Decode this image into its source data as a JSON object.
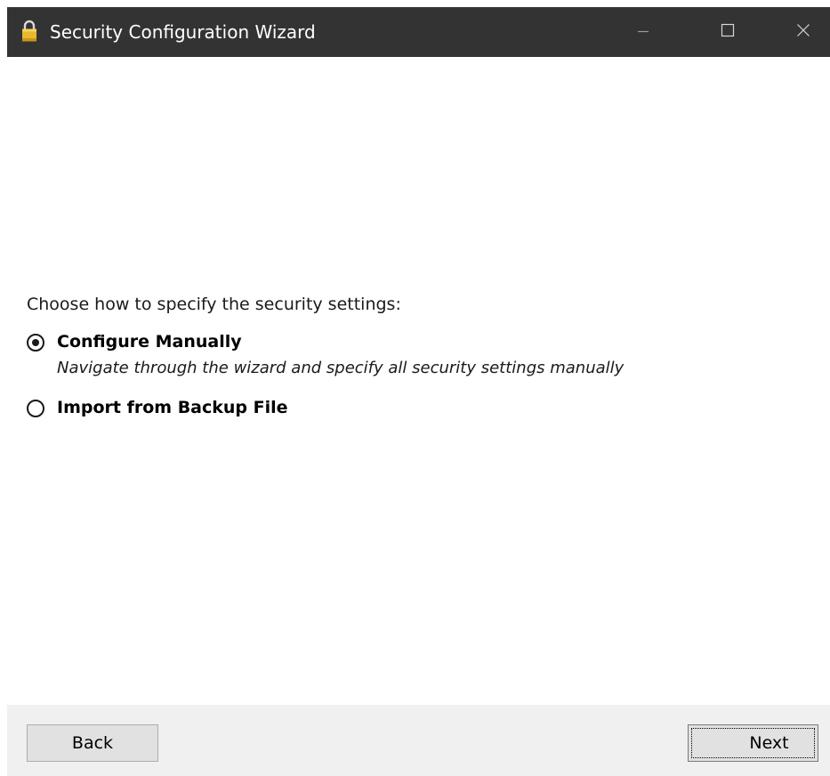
{
  "window": {
    "title": "Security Configuration Wizard",
    "icon": "padlock-icon",
    "controls": {
      "minimize_icon": "minimize-icon",
      "maximize_icon": "maximize-icon",
      "close_icon": "close-icon"
    }
  },
  "content": {
    "prompt": "Choose how to specify the security settings:",
    "options": [
      {
        "label": "Configure Manually",
        "description": "Navigate through the wizard and specify all security settings manually",
        "selected": true
      },
      {
        "label": "Import from Backup File",
        "description": "",
        "selected": false
      }
    ]
  },
  "footer": {
    "back_label": "Back",
    "next_label": "Next"
  },
  "colors": {
    "titlebar": "#333333",
    "title_text": "#ffffff",
    "footer_background": "#f0f0f0",
    "button_background": "#e1e1e1",
    "padlock": "#e8b92c"
  }
}
